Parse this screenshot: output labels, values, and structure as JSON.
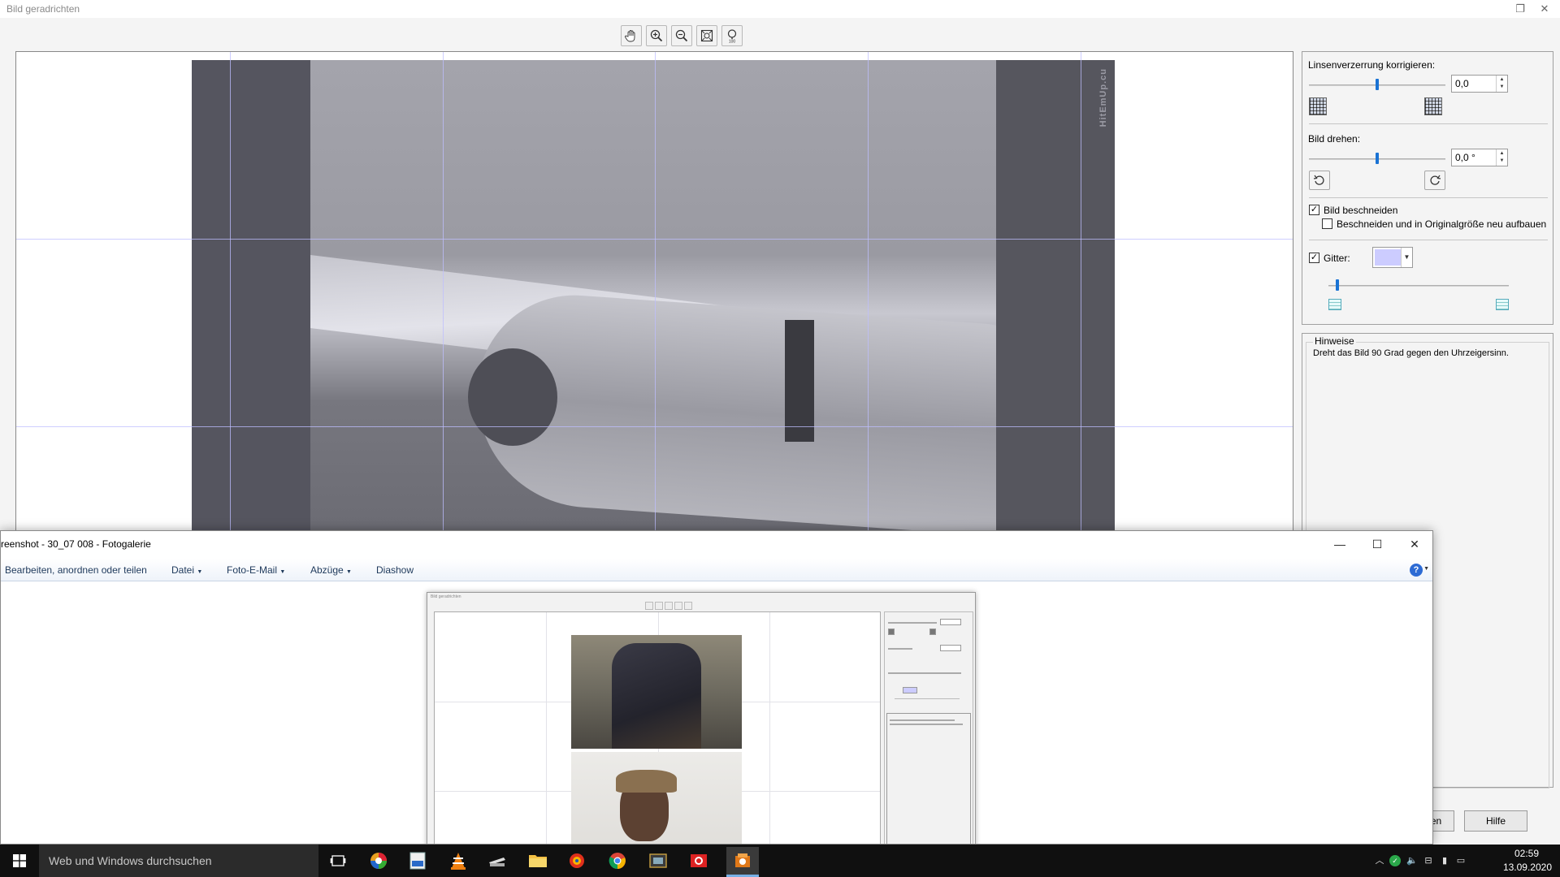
{
  "straighten_window": {
    "title": "Bild geradrichten",
    "settings": {
      "lens_label": "Linsenverzerrung korrigieren:",
      "lens_value": "0,0",
      "lens_slider_fraction": 0.5,
      "rotate_label": "Bild drehen:",
      "rotate_value": "0,0 °",
      "rotate_slider_fraction": 0.5,
      "crop_label": "Bild beschneiden",
      "crop_checked": true,
      "crop_rebuild_label": "Beschneiden und in Originalgröße neu aufbauen",
      "crop_rebuild_checked": false,
      "grid_label": "Gitter:",
      "grid_checked": true,
      "grid_color": "#ccccff",
      "grid_slider_fraction": 0.05
    },
    "hints": {
      "title": "Hinweise",
      "text": "Dreht das Bild 90 Grad gegen den Uhrzeigersinn."
    },
    "watermark": "HitEmUp.cu",
    "buttons": {
      "ok_partial": "en",
      "help": "Hilfe"
    },
    "toolbar_icons": [
      "hand-icon",
      "zoom-in-icon",
      "zoom-out-icon",
      "fit-icon",
      "actual-size-icon"
    ],
    "actual_size_badge": "100"
  },
  "gallery_window": {
    "title": "reenshot - 30_07 008 - Fotogalerie",
    "menu": [
      {
        "label": "Bearbeiten, anordnen oder teilen",
        "has_dropdown": false
      },
      {
        "label": "Datei",
        "has_dropdown": true
      },
      {
        "label": "Foto-E-Mail",
        "has_dropdown": true
      },
      {
        "label": "Abzüge",
        "has_dropdown": true
      },
      {
        "label": "Diashow",
        "has_dropdown": false
      }
    ],
    "help_label": "?"
  },
  "taskbar": {
    "search_placeholder": "Web und Windows durchsuchen",
    "time": "02:59",
    "date": "13.09.2020",
    "accent": "#77b0e6"
  }
}
